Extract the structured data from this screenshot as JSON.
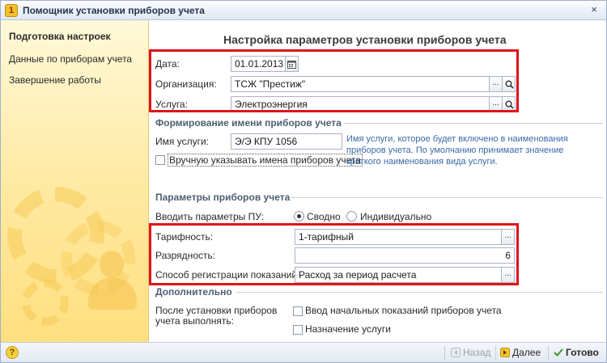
{
  "window": {
    "title": "Помощник установки приборов учета",
    "close_label": "×"
  },
  "sidebar": {
    "items": [
      {
        "label": "Подготовка настроек",
        "active": true
      },
      {
        "label": "Данные по приборам учета",
        "active": false
      },
      {
        "label": "Завершение работы",
        "active": false
      }
    ]
  },
  "main": {
    "heading": "Настройка параметров установки приборов учета",
    "date": {
      "label": "Дата:",
      "value": "01.01.2013"
    },
    "organization": {
      "label": "Организация:",
      "value": "ТСЖ \"Престиж\""
    },
    "service": {
      "label": "Услуга:",
      "value": "Электроэнергия"
    },
    "ellipsis": "...",
    "name_section": {
      "title": "Формирование имени приборов учета",
      "service_name_label": "Имя услуги:",
      "service_name_value": "Э/Э КПУ 1056",
      "manual_names_label": "Вручную указывать имена приборов учета",
      "manual_names_checked": false,
      "hint_lines": [
        "Имя услуги, которое будет включено в наименования",
        "приборов учета. По умолчанию принимает значение",
        "краткого наименования вида услуги."
      ]
    },
    "params_section": {
      "title": "Параметры приборов учета",
      "input_mode_label": "Вводить параметры ПУ:",
      "mode_options": [
        {
          "label": "Сводно",
          "selected": true
        },
        {
          "label": "Индивидуально",
          "selected": false
        }
      ],
      "tariff": {
        "label": "Тарифность:",
        "value": "1-тарифный"
      },
      "digits": {
        "label": "Разрядность:",
        "value": "6"
      },
      "registration": {
        "label": "Способ регистрации показаний:",
        "value": "Расход за период расчета"
      }
    },
    "extra_section": {
      "title": "Дополнительно",
      "after_label_lines": [
        "После установки приборов",
        "учета выполнять:"
      ],
      "initial_readings_label": "Ввод начальных показаний приборов учета",
      "initial_readings_checked": false,
      "assign_service_label": "Назначение услуги",
      "assign_service_checked": false
    }
  },
  "footer": {
    "help_label": "?",
    "back_label": "Назад",
    "next_label": "Далее",
    "done_label": "Готово"
  },
  "colors": {
    "highlight": "#e0131a",
    "section_title": "#4e5e73",
    "hint_text": "#3b6aa8",
    "sidebar_bg": "#ffe9a0"
  }
}
